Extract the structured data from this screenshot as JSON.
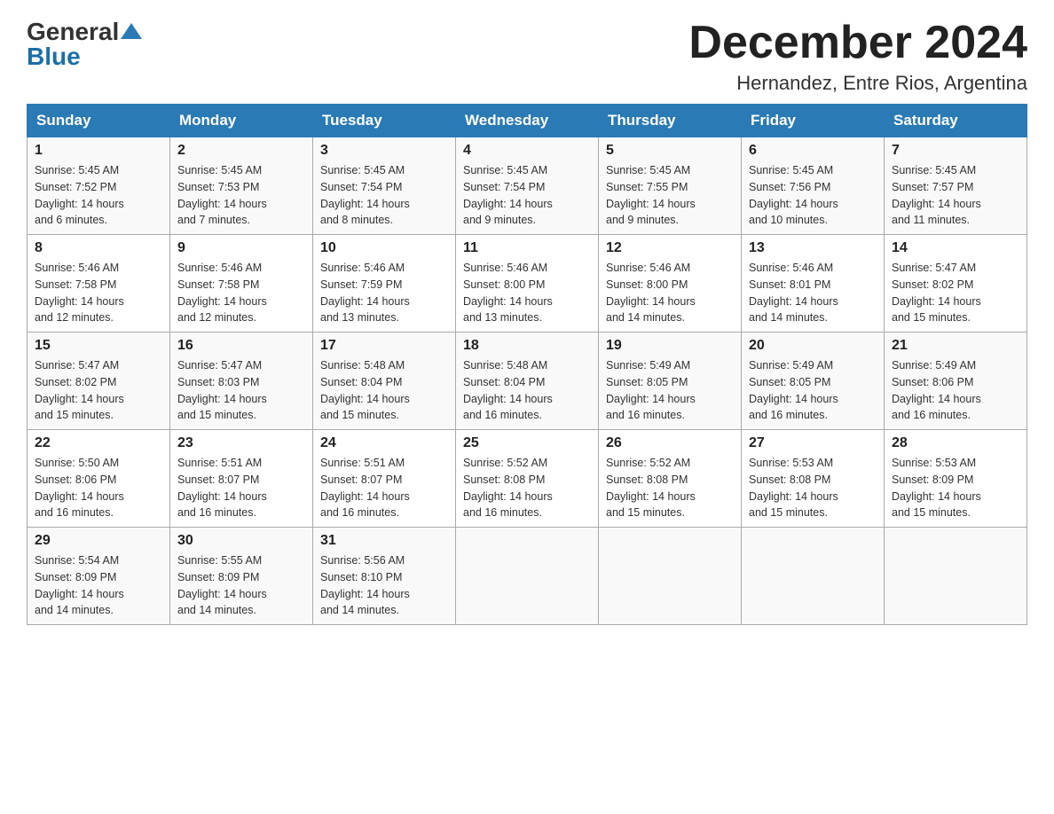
{
  "header": {
    "logo_general": "General",
    "logo_blue": "Blue",
    "month_title": "December 2024",
    "location": "Hernandez, Entre Rios, Argentina"
  },
  "days_of_week": [
    "Sunday",
    "Monday",
    "Tuesday",
    "Wednesday",
    "Thursday",
    "Friday",
    "Saturday"
  ],
  "weeks": [
    [
      {
        "day": "1",
        "sunrise": "5:45 AM",
        "sunset": "7:52 PM",
        "daylight": "14 hours and 6 minutes."
      },
      {
        "day": "2",
        "sunrise": "5:45 AM",
        "sunset": "7:53 PM",
        "daylight": "14 hours and 7 minutes."
      },
      {
        "day": "3",
        "sunrise": "5:45 AM",
        "sunset": "7:54 PM",
        "daylight": "14 hours and 8 minutes."
      },
      {
        "day": "4",
        "sunrise": "5:45 AM",
        "sunset": "7:54 PM",
        "daylight": "14 hours and 9 minutes."
      },
      {
        "day": "5",
        "sunrise": "5:45 AM",
        "sunset": "7:55 PM",
        "daylight": "14 hours and 9 minutes."
      },
      {
        "day": "6",
        "sunrise": "5:45 AM",
        "sunset": "7:56 PM",
        "daylight": "14 hours and 10 minutes."
      },
      {
        "day": "7",
        "sunrise": "5:45 AM",
        "sunset": "7:57 PM",
        "daylight": "14 hours and 11 minutes."
      }
    ],
    [
      {
        "day": "8",
        "sunrise": "5:46 AM",
        "sunset": "7:58 PM",
        "daylight": "14 hours and 12 minutes."
      },
      {
        "day": "9",
        "sunrise": "5:46 AM",
        "sunset": "7:58 PM",
        "daylight": "14 hours and 12 minutes."
      },
      {
        "day": "10",
        "sunrise": "5:46 AM",
        "sunset": "7:59 PM",
        "daylight": "14 hours and 13 minutes."
      },
      {
        "day": "11",
        "sunrise": "5:46 AM",
        "sunset": "8:00 PM",
        "daylight": "14 hours and 13 minutes."
      },
      {
        "day": "12",
        "sunrise": "5:46 AM",
        "sunset": "8:00 PM",
        "daylight": "14 hours and 14 minutes."
      },
      {
        "day": "13",
        "sunrise": "5:46 AM",
        "sunset": "8:01 PM",
        "daylight": "14 hours and 14 minutes."
      },
      {
        "day": "14",
        "sunrise": "5:47 AM",
        "sunset": "8:02 PM",
        "daylight": "14 hours and 15 minutes."
      }
    ],
    [
      {
        "day": "15",
        "sunrise": "5:47 AM",
        "sunset": "8:02 PM",
        "daylight": "14 hours and 15 minutes."
      },
      {
        "day": "16",
        "sunrise": "5:47 AM",
        "sunset": "8:03 PM",
        "daylight": "14 hours and 15 minutes."
      },
      {
        "day": "17",
        "sunrise": "5:48 AM",
        "sunset": "8:04 PM",
        "daylight": "14 hours and 15 minutes."
      },
      {
        "day": "18",
        "sunrise": "5:48 AM",
        "sunset": "8:04 PM",
        "daylight": "14 hours and 16 minutes."
      },
      {
        "day": "19",
        "sunrise": "5:49 AM",
        "sunset": "8:05 PM",
        "daylight": "14 hours and 16 minutes."
      },
      {
        "day": "20",
        "sunrise": "5:49 AM",
        "sunset": "8:05 PM",
        "daylight": "14 hours and 16 minutes."
      },
      {
        "day": "21",
        "sunrise": "5:49 AM",
        "sunset": "8:06 PM",
        "daylight": "14 hours and 16 minutes."
      }
    ],
    [
      {
        "day": "22",
        "sunrise": "5:50 AM",
        "sunset": "8:06 PM",
        "daylight": "14 hours and 16 minutes."
      },
      {
        "day": "23",
        "sunrise": "5:51 AM",
        "sunset": "8:07 PM",
        "daylight": "14 hours and 16 minutes."
      },
      {
        "day": "24",
        "sunrise": "5:51 AM",
        "sunset": "8:07 PM",
        "daylight": "14 hours and 16 minutes."
      },
      {
        "day": "25",
        "sunrise": "5:52 AM",
        "sunset": "8:08 PM",
        "daylight": "14 hours and 16 minutes."
      },
      {
        "day": "26",
        "sunrise": "5:52 AM",
        "sunset": "8:08 PM",
        "daylight": "14 hours and 15 minutes."
      },
      {
        "day": "27",
        "sunrise": "5:53 AM",
        "sunset": "8:08 PM",
        "daylight": "14 hours and 15 minutes."
      },
      {
        "day": "28",
        "sunrise": "5:53 AM",
        "sunset": "8:09 PM",
        "daylight": "14 hours and 15 minutes."
      }
    ],
    [
      {
        "day": "29",
        "sunrise": "5:54 AM",
        "sunset": "8:09 PM",
        "daylight": "14 hours and 14 minutes."
      },
      {
        "day": "30",
        "sunrise": "5:55 AM",
        "sunset": "8:09 PM",
        "daylight": "14 hours and 14 minutes."
      },
      {
        "day": "31",
        "sunrise": "5:56 AM",
        "sunset": "8:10 PM",
        "daylight": "14 hours and 14 minutes."
      },
      null,
      null,
      null,
      null
    ]
  ],
  "sunrise_label": "Sunrise:",
  "sunset_label": "Sunset:",
  "daylight_label": "Daylight:"
}
